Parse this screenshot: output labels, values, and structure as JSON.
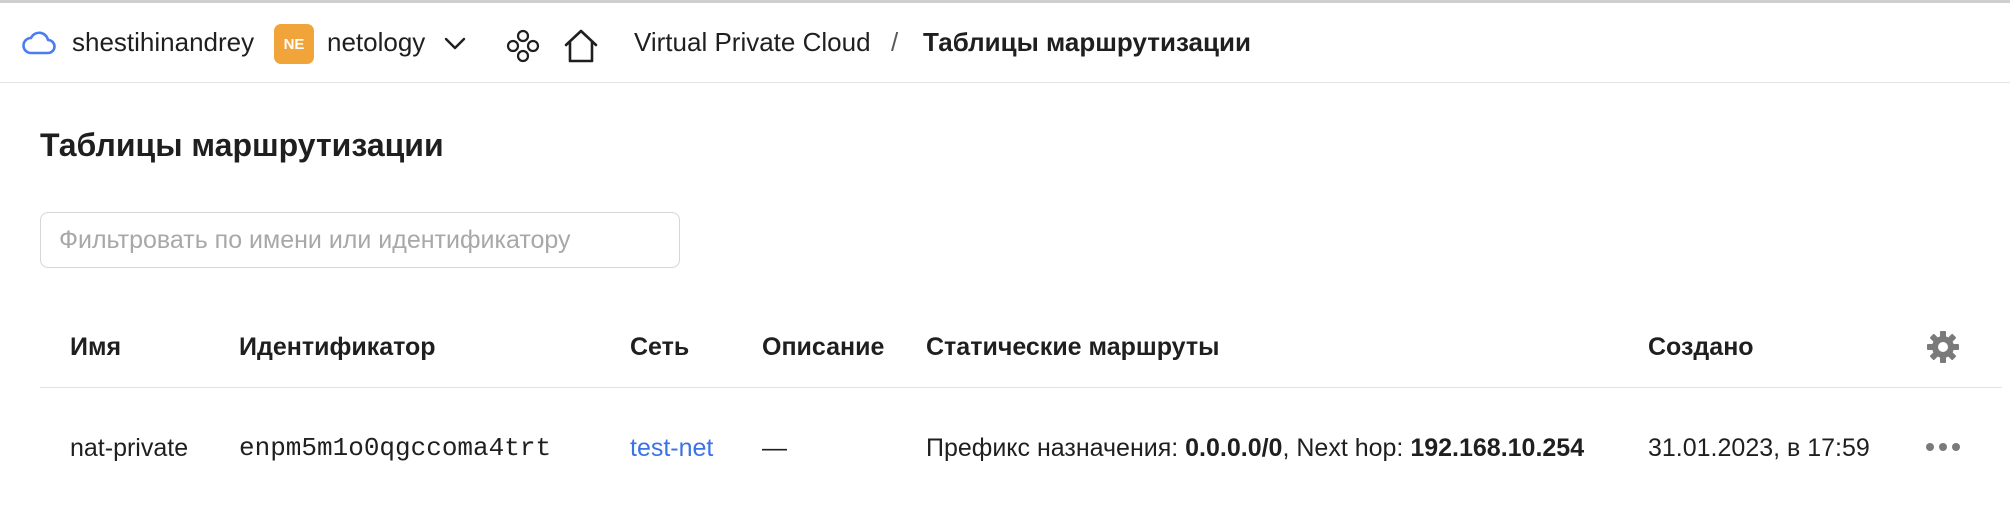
{
  "header": {
    "user_name": "shestihinandrey",
    "org_badge": "NE",
    "org_name": "netology",
    "breadcrumb": {
      "service": "Virtual Private Cloud",
      "separator": "/",
      "current": "Таблицы маршрутизации"
    },
    "icons": [
      "cloud-icon",
      "chevron-down-icon",
      "services-icon",
      "home-icon"
    ]
  },
  "page": {
    "title": "Таблицы маршрутизации",
    "search": {
      "placeholder": "Фильтровать по имени или идентификатору",
      "value": ""
    }
  },
  "table": {
    "columns": [
      "Имя",
      "Идентификатор",
      "Сеть",
      "Описание",
      "Статические маршруты",
      "Создано"
    ],
    "rows": [
      {
        "name": "nat-private",
        "id": "enpm5m1o0qgccoma4trt",
        "network": "test-net",
        "description": "—",
        "routes_prefix_label": "Префикс назначения: ",
        "routes_prefix_value": "0.0.0.0/0",
        "routes_nexthop_label": ", Next hop: ",
        "routes_nexthop_value": "192.168.10.254",
        "created": "31.01.2023, в 17:59"
      }
    ]
  },
  "colors": {
    "accent_link": "#3b73e6",
    "org_badge": "#f0a43a",
    "cloud_icon": "#4a7df0"
  }
}
